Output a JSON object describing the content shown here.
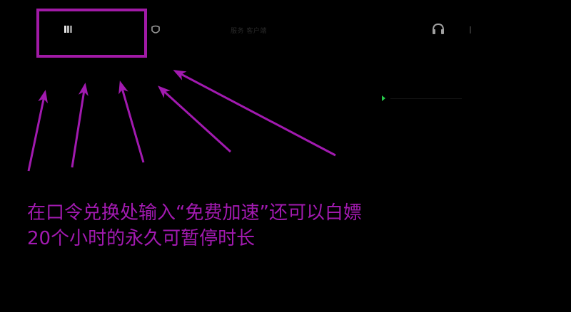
{
  "top_bar": {
    "nav_text": "服务 客户端"
  },
  "colors": {
    "highlight": "#a11aa6",
    "arrow": "#a21ab0",
    "caption": "#a21ab0",
    "status_dot": "#26c94a",
    "background": "#000000"
  },
  "icons": {
    "logo": "app-logo-icon",
    "secondary": "shield-icon",
    "right_a": "headset-icon",
    "right_b": "menu-icon",
    "status": "play-icon"
  },
  "caption": {
    "line1": "在口令兑换处输入“免费加速”还可以白嫖",
    "line2": "20个小时的永久可暂停时长"
  }
}
